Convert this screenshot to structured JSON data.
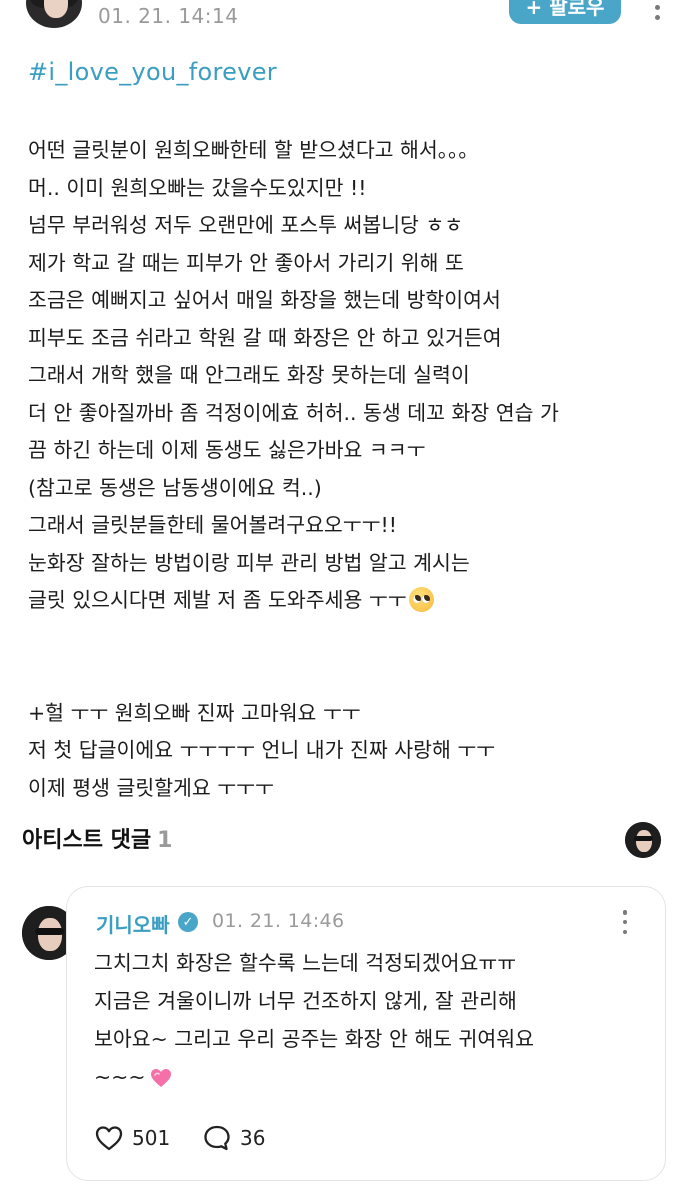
{
  "header": {
    "timestamp": "01. 21. 14:14",
    "follow_label": "+ 팔로우"
  },
  "post": {
    "hashtag": "#i_love_you_forever",
    "lines_part1": [
      "어떤 글릿분이 원희오빠한테 할 받으셨다고 해서。。。",
      "머.. 이미 원희오빠는 갔을수도있지만 !!",
      "넘무 부러워성 저두 오랜만에 포스투 써봅니당 ㅎㅎ",
      "제가 학교 갈 때는 피부가 안 좋아서 가리기 위해 또",
      "조금은 예뻐지고 싶어서 매일 화장을 했는데 방학이여서",
      "피부도 조금 쉬라고 학원 갈 때 화장은 안 하고 있거든여",
      "그래서 개학 했을 때 안그래도 화장 못하는데 실력이",
      "더 안 좋아질까바 좀 걱정이에효 허허.. 동생 데꼬 화장 연습 가",
      "끔 하긴 하는데 이제 동생도 싫은가바요 ㅋㅋㅜ",
      "(참고로 동생은 남동생이에요 컥..)",
      "그래서 글릿분들한테 물어볼려구요오ㅜㅜ!!",
      "눈화장 잘하는 방법이랑 피부 관리 방법 알고 계시는"
    ],
    "line_last_text": "글릿 있으시다면 제발 저 좀 도와주세용 ㅜㅜ",
    "lines_part2": [
      "+헐 ㅜㅜ 원희오빠 진짜 고마워요 ㅜㅜ",
      "저 첫 답글이에요 ㅜㅜㅜㅜ 언니 내가 진짜 사랑해 ㅜㅜ",
      "이제 평생 글릿할게요 ㅜㅜㅜ"
    ]
  },
  "artist_comments": {
    "title": "아티스트 댓글",
    "count": "1"
  },
  "comment": {
    "author": "기니오빠",
    "timestamp": "01. 21. 14:46",
    "lines": [
      "그치그치 화장은 할수록 느는데 걱정되겠어요ㅠㅠ",
      "지금은 겨울이니까 너무 건조하지 않게, 잘 관리해",
      "보아요~ 그리고 우리 공주는 화장 안 해도 귀여워요"
    ],
    "last_line_text": "~~~",
    "likes": "501",
    "replies": "36"
  },
  "icons": {
    "verified": "verified-badge-icon",
    "heart": "heart-outline-icon",
    "reply": "speech-bubble-icon",
    "more": "more-vertical-icon"
  },
  "colors": {
    "accent": "#4aa6c8",
    "hashtag": "#3a9ec2",
    "muted": "#9a9a9a"
  }
}
